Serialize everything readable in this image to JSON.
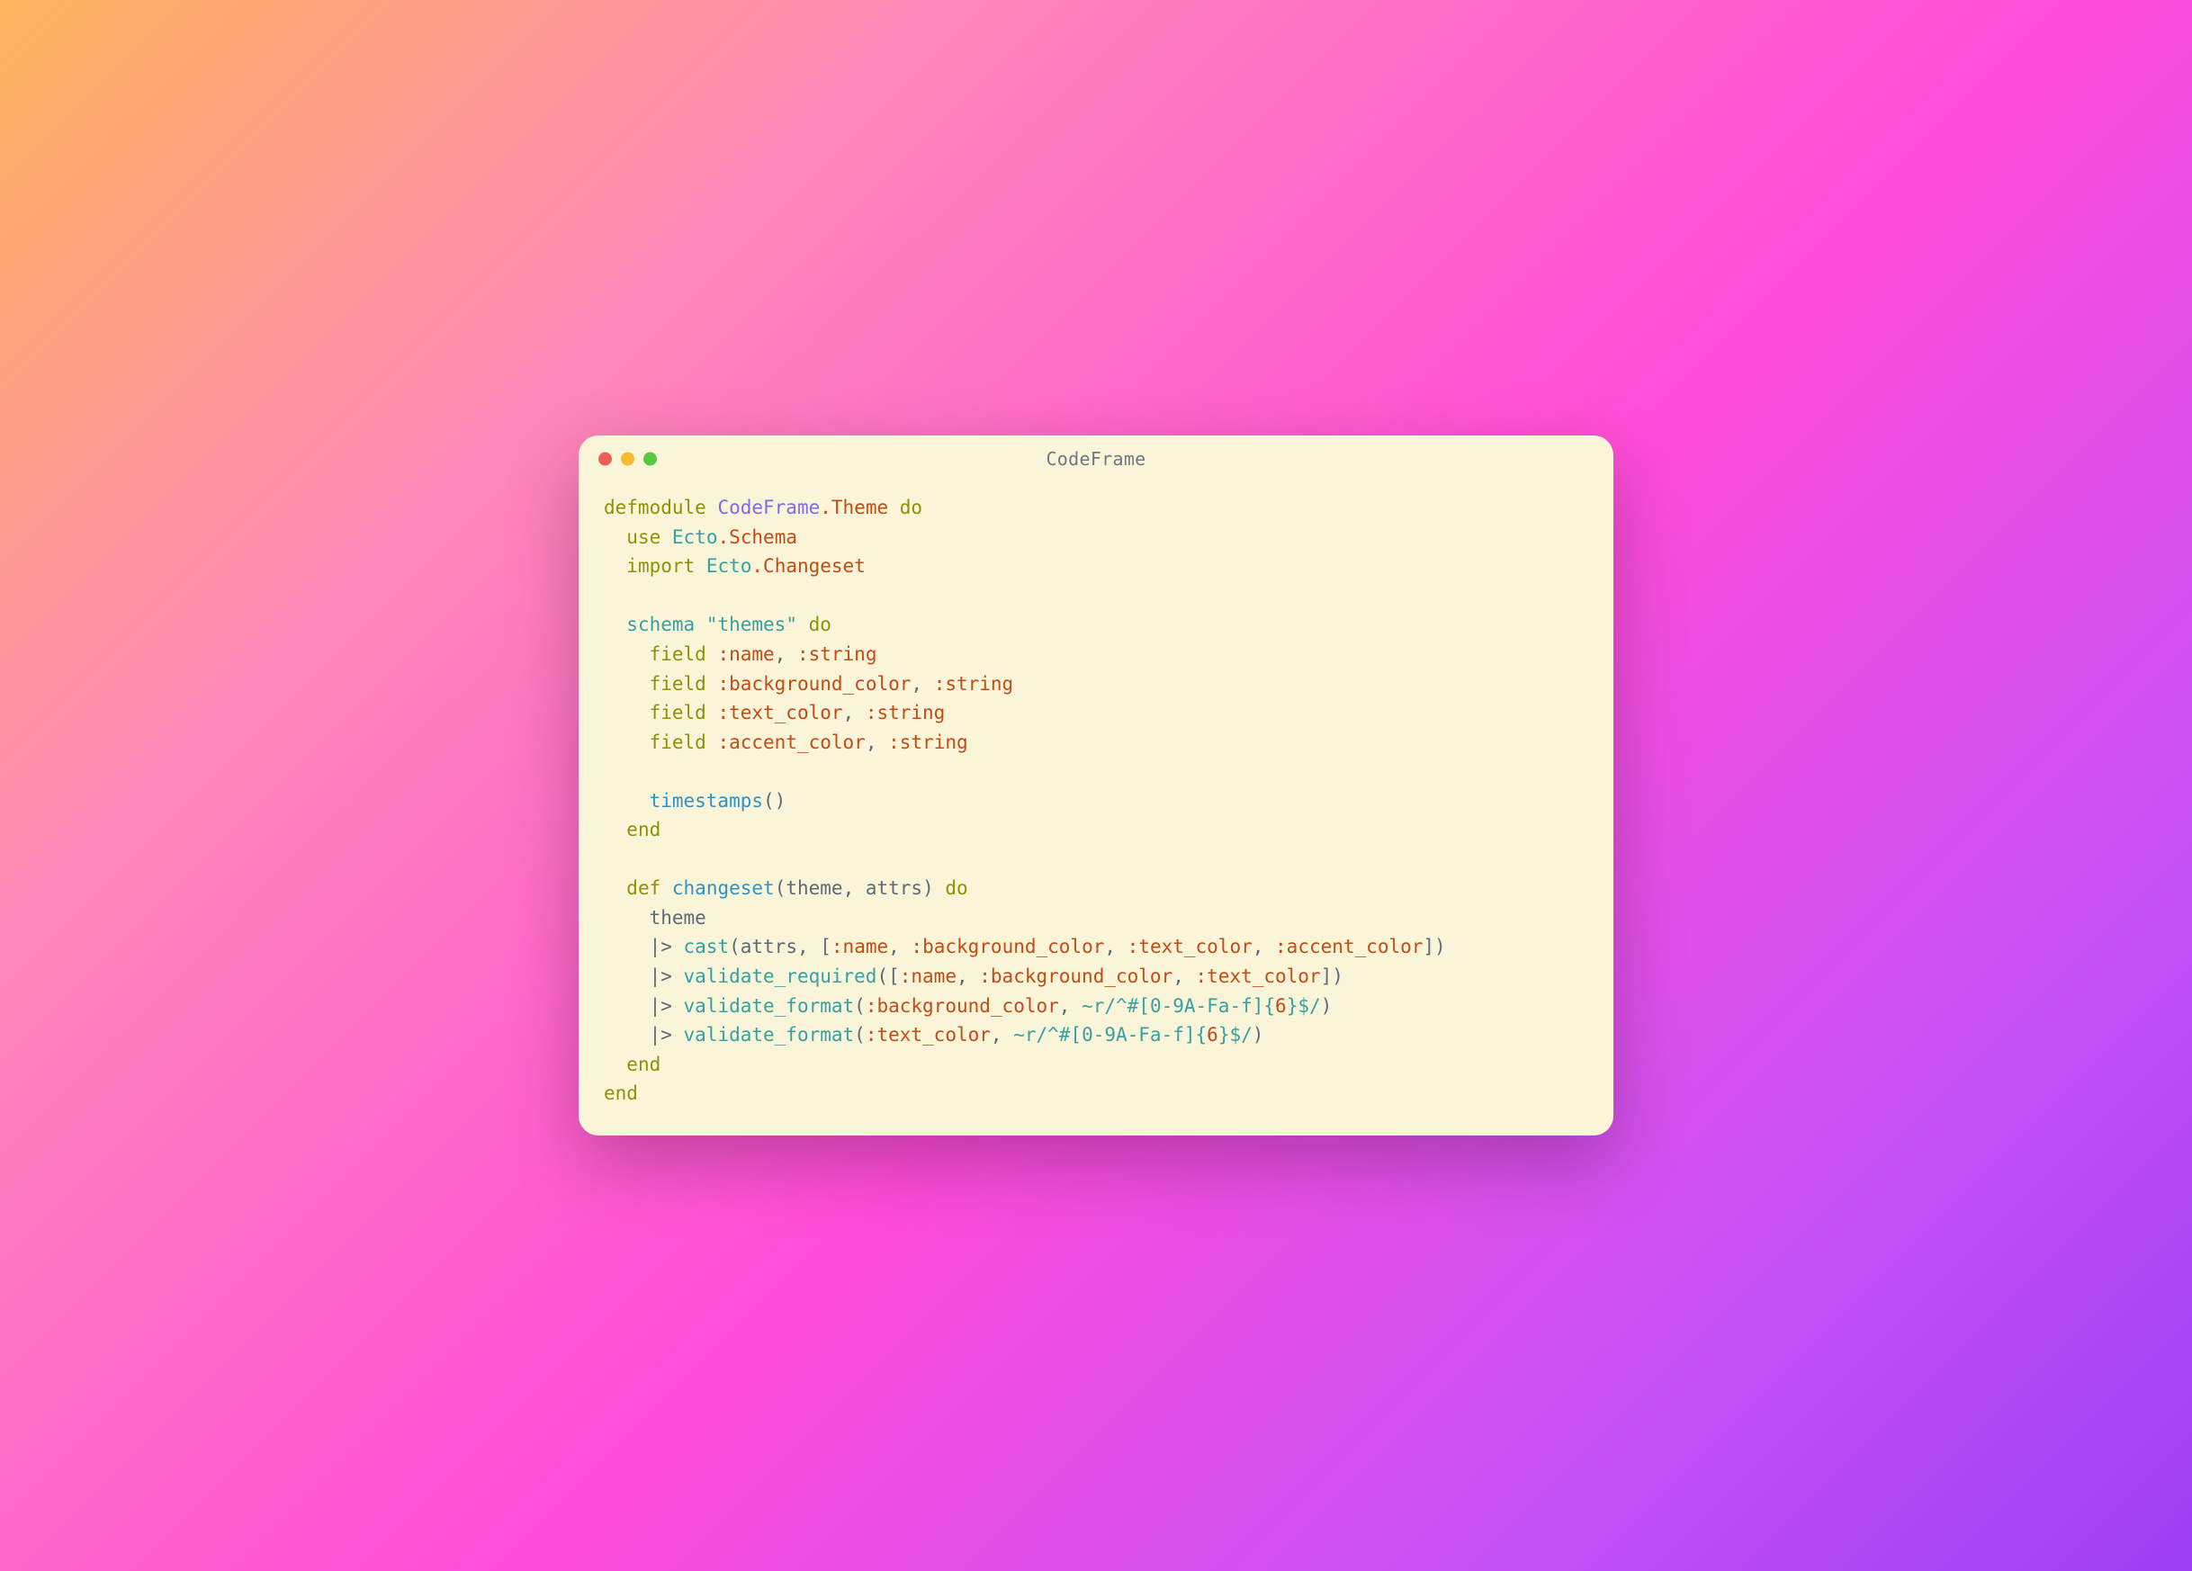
{
  "window": {
    "title": "CodeFrame"
  },
  "code": {
    "l1": {
      "defmodule": "defmodule",
      "sp": " ",
      "mod1": "CodeFrame",
      "dot1": ".",
      "mod2": "Theme",
      "sp2": " ",
      "do": "do"
    },
    "l2": {
      "indent": "  ",
      "use": "use",
      "sp": " ",
      "ecto": "Ecto",
      "dot": ".",
      "schema": "Schema"
    },
    "l3": {
      "indent": "  ",
      "import": "import",
      "sp": " ",
      "ecto": "Ecto",
      "dot": ".",
      "changeset": "Changeset"
    },
    "l4": "",
    "l5": {
      "indent": "  ",
      "schema": "schema",
      "sp": " ",
      "str": "\"themes\"",
      "sp2": " ",
      "do": "do"
    },
    "l6": {
      "indent": "    ",
      "field": "field",
      "sp": " ",
      "atom": ":name",
      "comma": ", ",
      "type": ":string"
    },
    "l7": {
      "indent": "    ",
      "field": "field",
      "sp": " ",
      "atom": ":background_color",
      "comma": ", ",
      "type": ":string"
    },
    "l8": {
      "indent": "    ",
      "field": "field",
      "sp": " ",
      "atom": ":text_color",
      "comma": ", ",
      "type": ":string"
    },
    "l9": {
      "indent": "    ",
      "field": "field",
      "sp": " ",
      "atom": ":accent_color",
      "comma": ", ",
      "type": ":string"
    },
    "l10": "",
    "l11": {
      "indent": "    ",
      "timestamps": "timestamps",
      "parens": "()"
    },
    "l12": {
      "indent": "  ",
      "end": "end"
    },
    "l13": "",
    "l14": {
      "indent": "  ",
      "def": "def",
      "sp": " ",
      "fn": "changeset",
      "open": "(",
      "arg1": "theme",
      "comma": ", ",
      "arg2": "attrs",
      "close": ")",
      "sp2": " ",
      "do": "do"
    },
    "l15": {
      "indent": "    ",
      "theme": "theme"
    },
    "l16": {
      "indent": "    ",
      "pipe": "|> ",
      "fn": "cast",
      "open": "(",
      "arg": "attrs",
      "comma": ", [",
      "a1": ":name",
      "c1": ", ",
      "a2": ":background_color",
      "c2": ", ",
      "a3": ":text_color",
      "c3": ", ",
      "a4": ":accent_color",
      "close": "])"
    },
    "l17": {
      "indent": "    ",
      "pipe": "|> ",
      "fn": "validate_required",
      "open": "([",
      "a1": ":name",
      "c1": ", ",
      "a2": ":background_color",
      "c2": ", ",
      "a3": ":text_color",
      "close": "])"
    },
    "l18": {
      "indent": "    ",
      "pipe": "|> ",
      "fn": "validate_format",
      "open": "(",
      "a1": ":background_color",
      "c1": ", ",
      "sig": "~r/",
      "body": "^#[",
      "range": "0-9A-Fa-f",
      "rest": "]{",
      "num": "6",
      "tail": "}$/",
      "close": ")"
    },
    "l19": {
      "indent": "    ",
      "pipe": "|> ",
      "fn": "validate_format",
      "open": "(",
      "a1": ":text_color",
      "c1": ", ",
      "sig": "~r/",
      "body": "^#[",
      "range": "0-9A-Fa-f",
      "rest": "]{",
      "num": "6",
      "tail": "}$/",
      "close": ")"
    },
    "l20": {
      "indent": "  ",
      "end": "end"
    },
    "l21": {
      "end": "end"
    }
  }
}
